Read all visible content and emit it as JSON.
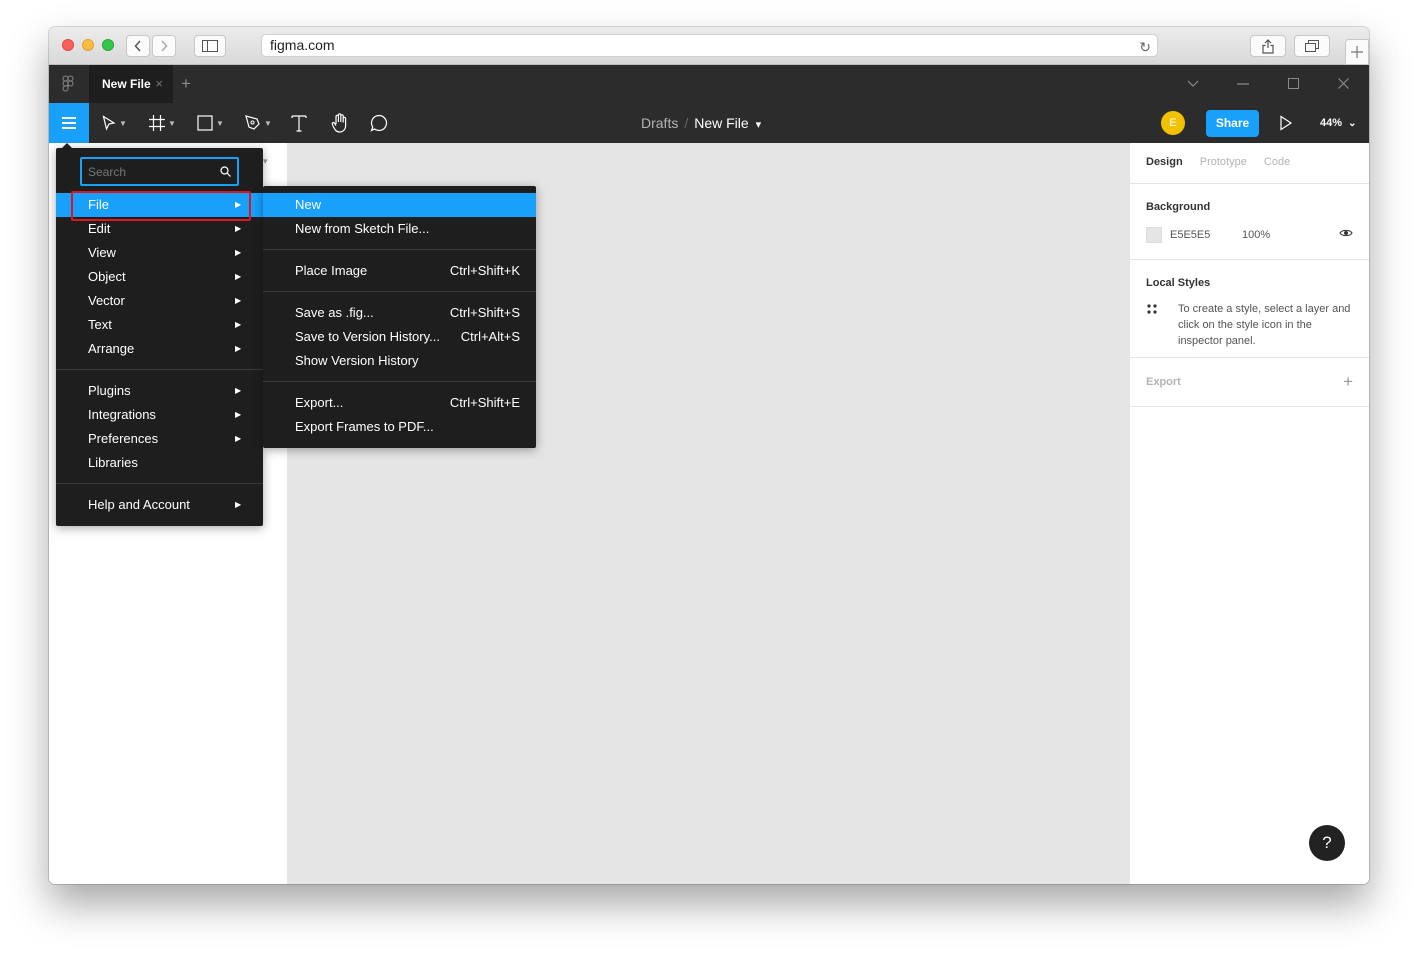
{
  "browser": {
    "url": "figma.com"
  },
  "figma": {
    "tab_title": "New File",
    "tab_close": "×",
    "tab_add": "+",
    "breadcrumb": {
      "parent": "Drafts",
      "separator": "/",
      "file": "New File",
      "chevron": "⌄"
    },
    "avatar_initial": "E",
    "share_label": "Share",
    "zoom": "44%"
  },
  "main_menu": {
    "search_placeholder": "Search",
    "items": [
      {
        "label": "File",
        "has_submenu": true,
        "active": true
      },
      {
        "label": "Edit",
        "has_submenu": true
      },
      {
        "label": "View",
        "has_submenu": true
      },
      {
        "label": "Object",
        "has_submenu": true
      },
      {
        "label": "Vector",
        "has_submenu": true
      },
      {
        "label": "Text",
        "has_submenu": true
      },
      {
        "label": "Arrange",
        "has_submenu": true
      },
      {
        "label": "Plugins",
        "has_submenu": true
      },
      {
        "label": "Integrations",
        "has_submenu": true
      },
      {
        "label": "Preferences",
        "has_submenu": true
      },
      {
        "label": "Libraries",
        "has_submenu": false
      },
      {
        "label": "Help and Account",
        "has_submenu": true
      }
    ]
  },
  "file_submenu": {
    "items": [
      {
        "label": "New",
        "shortcut": "",
        "active": true
      },
      {
        "label": "New from Sketch File...",
        "shortcut": ""
      },
      {
        "label": "Place Image",
        "shortcut": "Ctrl+Shift+K"
      },
      {
        "label": "Save as .fig...",
        "shortcut": "Ctrl+Shift+S"
      },
      {
        "label": "Save to Version History...",
        "shortcut": "Ctrl+Alt+S"
      },
      {
        "label": "Show Version History",
        "shortcut": ""
      },
      {
        "label": "Export...",
        "shortcut": "Ctrl+Shift+E"
      },
      {
        "label": "Export Frames to PDF...",
        "shortcut": ""
      }
    ]
  },
  "right_panel": {
    "tabs": [
      "Design",
      "Prototype",
      "Code"
    ],
    "background": {
      "title": "Background",
      "hex": "E5E5E5",
      "opacity": "100%",
      "color": "#e5e5e5"
    },
    "local_styles": {
      "title": "Local Styles",
      "hint": "To create a style, select a layer and click on the style icon in the inspector panel."
    },
    "export": {
      "title": "Export",
      "add": "+"
    },
    "help": "?"
  },
  "colors": {
    "accent": "#18a0fb",
    "highlight_border": "#e0141e",
    "dark": "#2c2c2c",
    "menu_bg": "#1e1e1e"
  }
}
